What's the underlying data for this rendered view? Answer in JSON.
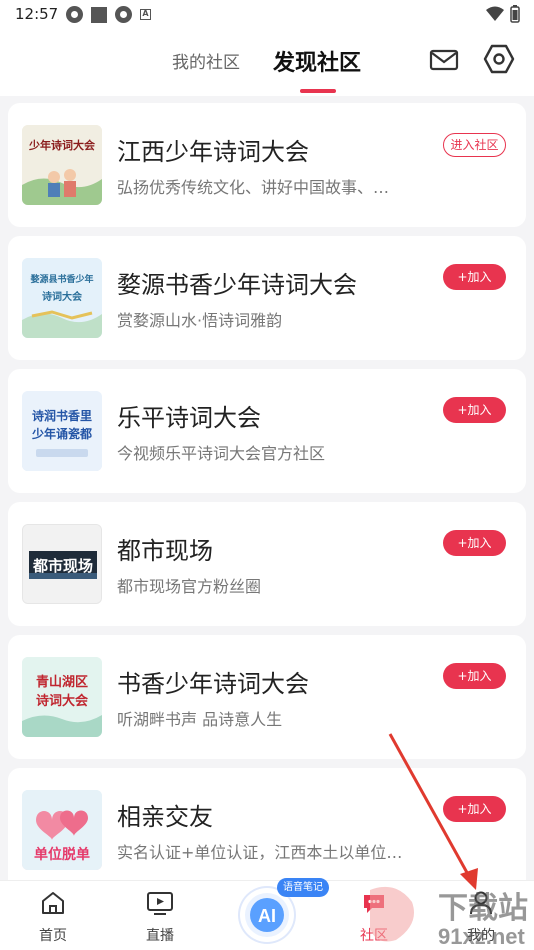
{
  "status": {
    "time": "12:57"
  },
  "topnav": {
    "tab_my": "我的社区",
    "tab_find": "发现社区"
  },
  "communities": [
    {
      "title": "江西少年诗词大会",
      "desc": "弘扬优秀传统文化、讲好中国故事、…",
      "action": "进入社区",
      "thumb_text": "少年诗词大会"
    },
    {
      "title": "婺源书香少年诗词大会",
      "desc": "赏婺源山水·悟诗词雅韵",
      "action": "+加入",
      "thumb_text_1": "婺源县书香少年",
      "thumb_text_2": "诗词大会"
    },
    {
      "title": "乐平诗词大会",
      "desc": "今视频乐平诗词大会官方社区",
      "action": "+加入",
      "thumb_text_1": "诗润书香里",
      "thumb_text_2": "少年诵瓷都"
    },
    {
      "title": "都市现场",
      "desc": "都市现场官方粉丝圈",
      "action": "+加入",
      "thumb_text": "都市现场"
    },
    {
      "title": "书香少年诗词大会",
      "desc": "听湖畔书声 品诗意人生",
      "action": "+加入",
      "thumb_text_1": "青山湖区",
      "thumb_text_2": "诗词大会"
    },
    {
      "title": "相亲交友",
      "desc": "实名认证+单位认证，江西本土以单位…",
      "action": "+加入",
      "thumb_text": "单位脱单"
    }
  ],
  "bottom_nav": {
    "home": "首页",
    "live": "直播",
    "ai_badge": "语音笔记",
    "community": "社区",
    "mine": "我的"
  },
  "watermark": {
    "text_1": "下载站",
    "text_2": "91xz.net"
  },
  "colors": {
    "accent": "#e8344f",
    "ai_blue": "#3a84f5"
  }
}
